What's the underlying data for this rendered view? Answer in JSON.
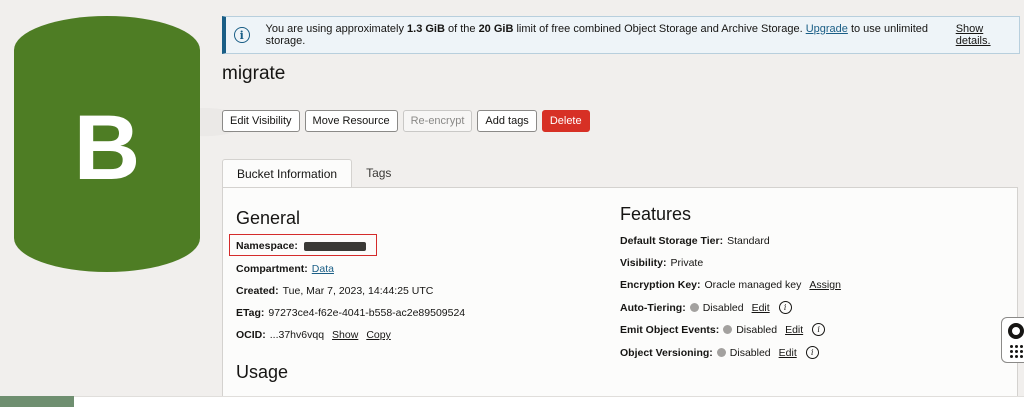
{
  "bucket_icon": {
    "letter": "B",
    "color": "#4e7d24"
  },
  "banner": {
    "prefix": "You are using approximately ",
    "used": "1.3 GiB",
    "middle": " of the ",
    "limit": "20 GiB",
    "suffix": " limit of free combined Object Storage and Archive Storage. ",
    "upgrade_link": "Upgrade",
    "tail": " to use unlimited storage.",
    "show_details": "Show details."
  },
  "page_title": "migrate",
  "actions": {
    "edit_visibility": "Edit Visibility",
    "move_resource": "Move Resource",
    "re_encrypt": "Re-encrypt",
    "add_tags": "Add tags",
    "delete": "Delete"
  },
  "tabs": {
    "bucket_information": "Bucket Information",
    "tags": "Tags"
  },
  "general": {
    "heading": "General",
    "namespace_label": "Namespace:",
    "compartment_label": "Compartment:",
    "compartment_value": "Data",
    "created_label": "Created:",
    "created_value": "Tue, Mar 7, 2023, 14:44:25 UTC",
    "etag_label": "ETag:",
    "etag_value": "97273ce4-f62e-4041-b558-ac2e89509524",
    "ocid_label": "OCID:",
    "ocid_value": "...37hv6vqq",
    "ocid_show": "Show",
    "ocid_copy": "Copy"
  },
  "usage": {
    "heading": "Usage"
  },
  "features": {
    "heading": "Features",
    "storage_tier_label": "Default Storage Tier:",
    "storage_tier_value": "Standard",
    "visibility_label": "Visibility:",
    "visibility_value": "Private",
    "encryption_label": "Encryption Key:",
    "encryption_value": "Oracle managed key",
    "encryption_assign": "Assign",
    "auto_tiering_label": "Auto-Tiering:",
    "auto_tiering_value": "Disabled",
    "auto_tiering_edit": "Edit",
    "emit_events_label": "Emit Object Events:",
    "emit_events_value": "Disabled",
    "emit_events_edit": "Edit",
    "versioning_label": "Object Versioning:",
    "versioning_value": "Disabled",
    "versioning_edit": "Edit"
  },
  "icons": {
    "info": "info-icon",
    "help": "help-icon",
    "lifebuoy": "lifebuoy-icon",
    "grid": "grid-icon"
  },
  "colors": {
    "accent_blue": "#1a5e86",
    "danger": "#d73025",
    "bucket_green": "#4e7d24",
    "highlight_box": "#d42b2b"
  }
}
